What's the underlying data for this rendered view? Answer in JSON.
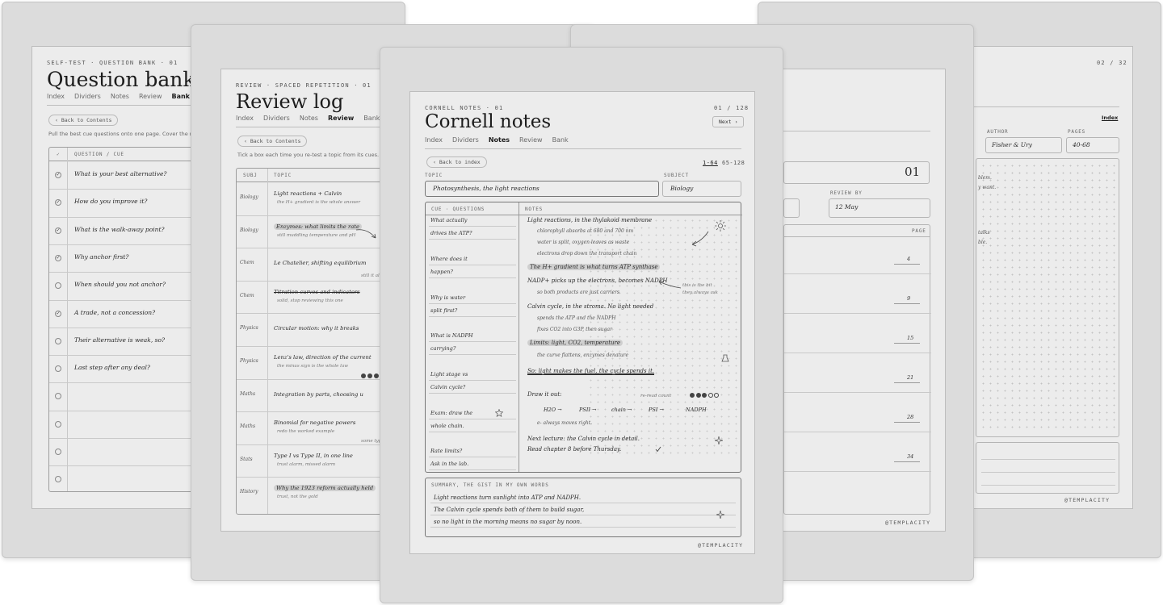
{
  "logo": "@TEMPLACITY",
  "question_bank": {
    "kicker": "SELF-TEST · QUESTION BANK · 01",
    "title": "Question bank",
    "tabs": [
      "Index",
      "Dividers",
      "Notes",
      "Review",
      "Bank"
    ],
    "active_tab": "Bank",
    "back_label": "‹ Back to Contents",
    "description": "Pull the best cue questions onto one page. Cover the right colu",
    "col_check": "✓",
    "col_question": "QUESTION / CUE",
    "rows": [
      {
        "text": "What is your best alternative?",
        "checked": true
      },
      {
        "text": "How do you improve it?",
        "checked": true
      },
      {
        "text": "What is the walk-away point?",
        "checked": true
      },
      {
        "text": "Why anchor first?",
        "checked": true
      },
      {
        "text": "When should you not anchor?",
        "checked": false
      },
      {
        "text": "A trade, not a concession?",
        "checked": true
      },
      {
        "text": "Their alternative is weak, so?",
        "checked": false
      },
      {
        "text": "Last step after any deal?",
        "checked": false
      },
      {
        "text": "",
        "checked": false
      },
      {
        "text": "",
        "checked": false
      },
      {
        "text": "",
        "checked": false
      },
      {
        "text": "",
        "checked": false
      }
    ]
  },
  "review_log": {
    "kicker": "REVIEW · SPACED REPETITION · 01",
    "title": "Review log",
    "tabs": [
      "Index",
      "Dividers",
      "Notes",
      "Review",
      "Bank"
    ],
    "active_tab": "Review",
    "back_label": "‹ Back to Contents",
    "description": "Tick a box each time you re-test a topic from its cues. The five g",
    "col_subj": "SUBJ",
    "col_topic": "TOPIC",
    "rows": [
      {
        "subject": "Biology",
        "topic": "Light reactions + Calvin",
        "sub": "the H+ gradient is the whole answer",
        "highlight": false,
        "strike": false
      },
      {
        "subject": "Biology",
        "topic": "Enzymes: what limits the rate",
        "sub": "still muddling temperature and pH",
        "highlight": true,
        "strike": false
      },
      {
        "subject": "Chem",
        "topic": "Le Chatelier, shifting equilibrium",
        "sub": "",
        "highlight": false,
        "strike": false
      },
      {
        "subject": "Chem",
        "topic": "Titration curves and indicators",
        "sub": "solid, stop reviewing this one",
        "highlight": false,
        "strike": true
      },
      {
        "subject": "Physics",
        "topic": "Circular motion: why it breaks",
        "sub": "",
        "highlight": false,
        "strike": false
      },
      {
        "subject": "Physics",
        "topic": "Lenz's law, direction of the current",
        "sub": "the minus sign is the whole law",
        "highlight": false,
        "strike": false
      },
      {
        "subject": "Maths",
        "topic": "Integration by parts, choosing u",
        "sub": "",
        "highlight": false,
        "strike": false
      },
      {
        "subject": "Maths",
        "topic": "Binomial for negative powers",
        "sub": "redo the worked example",
        "highlight": false,
        "strike": false
      },
      {
        "subject": "Stats",
        "topic": "Type I vs Type II, in one line",
        "sub": "trust alarm, missed alarm",
        "highlight": false,
        "strike": false
      },
      {
        "subject": "History",
        "topic": "Why the 1923 reform actually held",
        "sub": "trust, not the gold",
        "highlight": true,
        "strike": false
      }
    ],
    "margin_notes": [
      "still it all",
      "some type"
    ]
  },
  "cornell": {
    "kicker": "CORNELL NOTES · 01",
    "page_counter": "01 / 128",
    "next_label": "Next ›",
    "title": "Cornell notes",
    "tabs": [
      "Index",
      "Dividers",
      "Notes",
      "Review",
      "Bank"
    ],
    "active_tab": "Notes",
    "back_label": "‹ Back to index",
    "range_active": "1-64",
    "range_other": "65-128",
    "topic_label": "TOPIC",
    "topic_value": "Photosynthesis, the light reactions",
    "subject_label": "SUBJECT",
    "subject_value": "Biology",
    "cue_header": "CUE · QUESTIONS",
    "notes_header": "NOTES",
    "cues": [
      "What actually",
      "drives the ATP?",
      "Where does it",
      "happen?",
      "Why is water",
      "split first?",
      "What is NADPH",
      "carrying?",
      "Light stage vs",
      "Calvin cycle?",
      "Exam: draw the",
      "whole chain.",
      "Rate limits?",
      "Ask in the lab."
    ],
    "notes": [
      {
        "text": "Light reactions, in the thylakoid membrane",
        "style": "main"
      },
      {
        "text": "chlorophyll absorbs at 680 and 700 nm",
        "style": "indent"
      },
      {
        "text": "water is split, oxygen leaves as waste",
        "style": "indent"
      },
      {
        "text": "electrons drop down the transport chain",
        "style": "indent"
      },
      {
        "text": "The H+ gradient is what turns ATP synthase",
        "style": "highlight"
      },
      {
        "text": "NADP+ picks up the electrons, becomes NADPH",
        "style": "main"
      },
      {
        "text": "so both products are just carriers",
        "style": "small"
      },
      {
        "text": "Calvin cycle, in the stroma. No light needed",
        "style": "main"
      },
      {
        "text": "spends the ATP and the NADPH",
        "style": "indent"
      },
      {
        "text": "fixes CO2 into G3P, then sugar",
        "style": "indent"
      },
      {
        "text": "Limits: light, CO2, temperature",
        "style": "highlight"
      },
      {
        "text": "the curve flattens, enzymes denature",
        "style": "small"
      },
      {
        "text": "So: light makes the fuel, the cycle spends it.",
        "style": "underline"
      },
      {
        "text": "Draw it out:",
        "style": "main"
      },
      {
        "text": "H2O →",
        "style": "chain"
      },
      {
        "text": "PSII →",
        "style": "chain"
      },
      {
        "text": "chain →",
        "style": "chain"
      },
      {
        "text": "PSI →",
        "style": "chain"
      },
      {
        "text": "NADPH",
        "style": "chain"
      },
      {
        "text": "e- always moves right.",
        "style": "small"
      },
      {
        "text": "Next lecture: the Calvin cycle in detail.",
        "style": "main"
      },
      {
        "text": "Read chapter 8 before Thursday.",
        "style": "main"
      }
    ],
    "side_note_1": "this is the bit",
    "side_note_2": "they always ask",
    "reread_label": "re-read count",
    "summary_header": "SUMMARY, THE GIST IN MY OWN WORDS",
    "summary": [
      "Light reactions turn sunlight into ATP and NADPH.",
      "The Calvin cycle spends both of them to build sugar,",
      "so no light in the morning means no sugar by noon."
    ]
  },
  "sources": {
    "page_counter": "02 / 32",
    "tab_index": "Index",
    "author_label": "AUTHOR",
    "author_value": "Fisher & Ury",
    "pages_label": "PAGES",
    "pages_value": "40-68",
    "review_by_label": "REVIEW BY",
    "review_by_value": "12 May",
    "number": "01",
    "page_col": "PAGE",
    "page_values": [
      "4",
      "9",
      "15",
      "21",
      "28",
      "34"
    ],
    "fragments": [
      "blem.",
      "y want.",
      "talks",
      "ble."
    ]
  },
  "progress_dots": {
    "filled": 3,
    "total": 5
  }
}
